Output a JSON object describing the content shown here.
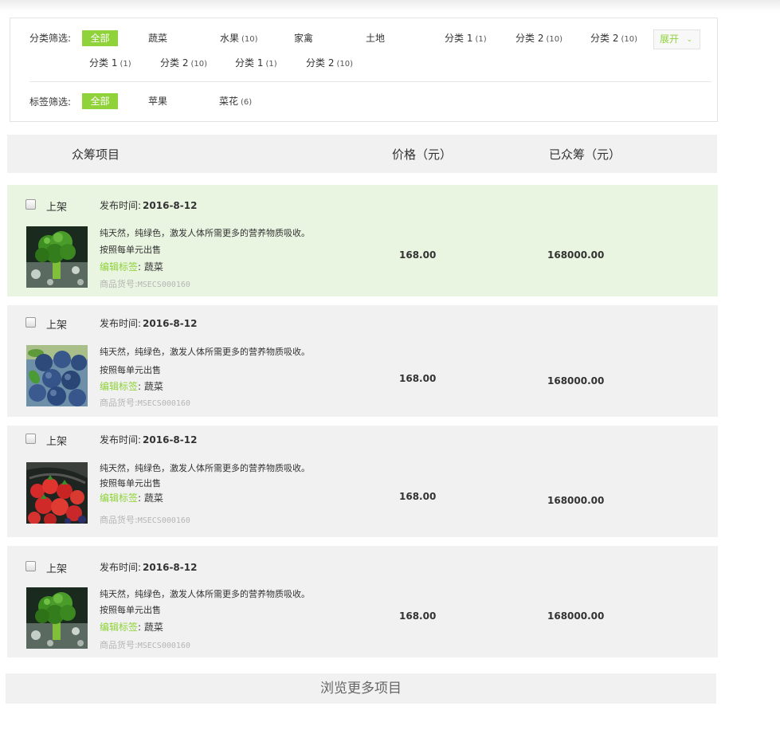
{
  "filters": {
    "category_label": "分类筛选:",
    "tag_label": "标签筛选:",
    "categories_row1": [
      {
        "name": "全部",
        "count": ""
      },
      {
        "name": "蔬菜",
        "count": ""
      },
      {
        "name": "水果",
        "count": "(10)"
      },
      {
        "name": "家禽",
        "count": ""
      },
      {
        "name": "土地",
        "count": ""
      },
      {
        "name": "分类 1",
        "count": "(1)"
      },
      {
        "name": "分类 2",
        "count": "(10)"
      },
      {
        "name": "分类 2",
        "count": "(10)"
      }
    ],
    "categories_row2": [
      {
        "name": "分类 1",
        "count": "(1)"
      },
      {
        "name": "分类 2",
        "count": "(10)"
      },
      {
        "name": "分类 1",
        "count": "(1)"
      },
      {
        "name": "分类 2",
        "count": "(10)"
      }
    ],
    "expand_label": "展开",
    "tags": [
      {
        "name": "全部",
        "count": ""
      },
      {
        "name": "苹果",
        "count": ""
      },
      {
        "name": "菜花",
        "count": "(6)"
      }
    ]
  },
  "table": {
    "col_project": "众筹项目",
    "col_price": "价格（元）",
    "col_raised": "已众筹（元）"
  },
  "rows": [
    {
      "status": "上架",
      "date_label": "发布时间:",
      "date": "2016-8-12",
      "desc": "纯天然，纯绿色，激发人体所需更多的营养物质吸收。",
      "unit": "按照每单元出售",
      "tag_label": "编辑标签",
      "tag_value": "蔬菜",
      "sku_label": "商品货号:",
      "sku": "MSECS000160",
      "price": "168.00",
      "raised": "168000.00",
      "image": "broccoli"
    },
    {
      "status": "上架",
      "date_label": "发布时间:",
      "date": "2016-8-12",
      "desc": "纯天然，纯绿色，激发人体所需更多的营养物质吸收。",
      "unit": "按照每单元出售",
      "tag_label": "编辑标签",
      "tag_value": "蔬菜",
      "sku_label": "商品货号:",
      "sku": "MSECS000160",
      "price": "168.00",
      "raised": "168000.00",
      "image": "blueberries"
    },
    {
      "status": "上架",
      "date_label": "发布时间:",
      "date": "2016-8-12",
      "desc": "纯天然，纯绿色，激发人体所需更多的营养物质吸收。",
      "unit": "按照每单元出售",
      "tag_label": "编辑标签",
      "tag_value": "蔬菜",
      "sku_label": "商品货号:",
      "sku": "MSECS000160",
      "price": "168.00",
      "raised": "168000.00",
      "image": "strawberries"
    },
    {
      "status": "上架",
      "date_label": "发布时间:",
      "date": "2016-8-12",
      "desc": "纯天然，纯绿色，激发人体所需更多的营养物质吸收。",
      "unit": "按照每单元出售",
      "tag_label": "编辑标签",
      "tag_value": "蔬菜",
      "sku_label": "商品货号:",
      "sku": "MSECS000160",
      "price": "168.00",
      "raised": "168000.00",
      "image": "broccoli"
    }
  ],
  "more_label": "浏览更多项目",
  "colors": {
    "accent": "#8fd23a",
    "row_bg": "#f1f1f1",
    "row_highlight": "#e9f4e1"
  }
}
